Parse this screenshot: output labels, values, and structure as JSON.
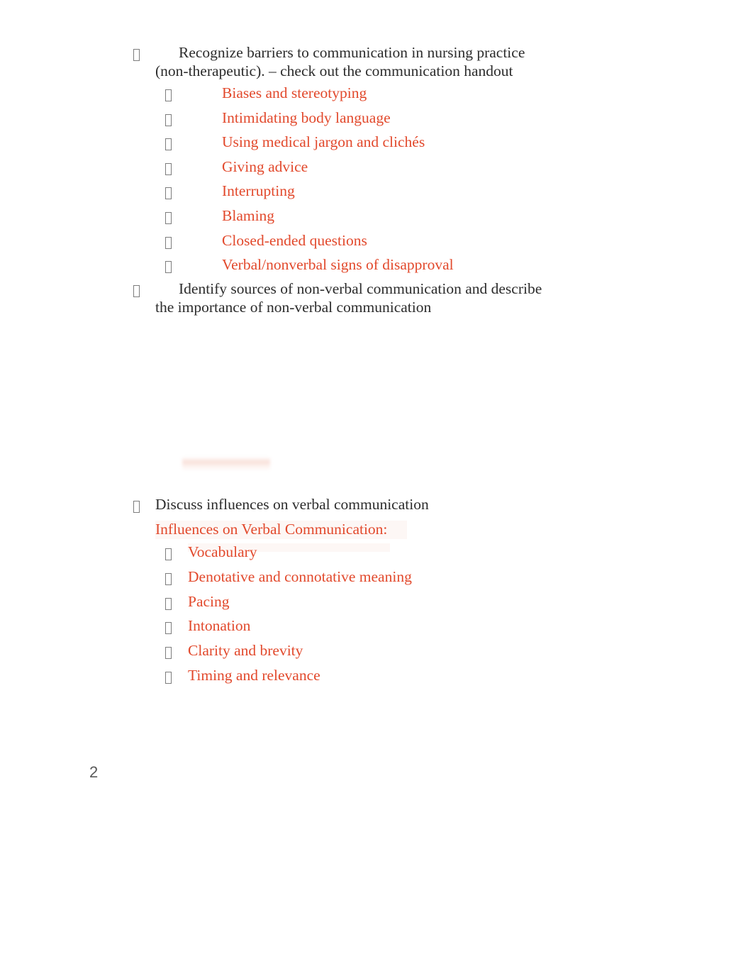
{
  "document": {
    "page_number": "2",
    "text_color": "#2c2c2c",
    "accent_color": "#e2492c",
    "page_number_color": "#595959",
    "bullet_glyph": "missing-glyph-box",
    "blocks": [
      {
        "id": "barriers",
        "level": 1,
        "color": "black",
        "text": "Recognize barriers to communication in nursing practice (non-therapeutic). – check out the communication handout"
      },
      {
        "id": "identify_nonverbal",
        "level": 1,
        "color": "black",
        "text": "Identify sources of non-verbal communication and describe the importance of non-verbal communication"
      },
      {
        "id": "discuss_influences",
        "level": 1,
        "color": "black",
        "text": "Discuss influences on verbal communication"
      }
    ],
    "barriers_list": [
      "Biases and stereotyping",
      "Intimidating body language",
      "Using medical jargon and clichés",
      "Giving advice",
      "Interrupting",
      "Blaming",
      "Closed-ended questions",
      "Verbal/nonverbal signs of disapproval"
    ],
    "influences_heading": "Influences on Verbal Communication:",
    "influences_list": [
      "Vocabulary",
      "Denotative and connotative meaning",
      "Pacing",
      "Intonation",
      "Clarity and brevity",
      "Timing and relevance"
    ]
  }
}
